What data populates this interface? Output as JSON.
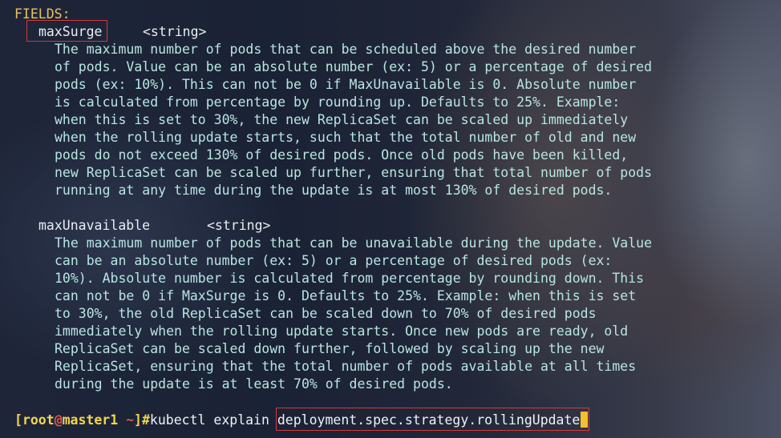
{
  "terminal": {
    "fields_header": "FIELDS:",
    "fields": [
      {
        "name": "maxSurge",
        "type": "<string>",
        "description": [
          "The maximum number of pods that can be scheduled above the desired number",
          "of pods. Value can be an absolute number (ex: 5) or a percentage of desired",
          "pods (ex: 10%). This can not be 0 if MaxUnavailable is 0. Absolute number",
          "is calculated from percentage by rounding up. Defaults to 25%. Example:",
          "when this is set to 30%, the new ReplicaSet can be scaled up immediately",
          "when the rolling update starts, such that the total number of old and new",
          "pods do not exceed 130% of desired pods. Once old pods have been killed,",
          "new ReplicaSet can be scaled up further, ensuring that total number of pods",
          "running at any time during the update is at most 130% of desired pods."
        ]
      },
      {
        "name": "maxUnavailable",
        "type": "<string>",
        "description": [
          "The maximum number of pods that can be unavailable during the update. Value",
          "can be an absolute number (ex: 5) or a percentage of desired pods (ex:",
          "10%). Absolute number is calculated from percentage by rounding down. This",
          "can not be 0 if MaxSurge is 0. Defaults to 25%. Example: when this is set",
          "to 30%, the old ReplicaSet can be scaled down to 70% of desired pods",
          "immediately when the rolling update starts. Once new pods are ready, old",
          "ReplicaSet can be scaled down further, followed by scaling up the new",
          "ReplicaSet, ensuring that the total number of pods available at all times",
          "during the update is at least 70% of desired pods."
        ]
      }
    ],
    "prompt": {
      "open_bracket": "[",
      "user": "root",
      "at": "@",
      "host": "master1",
      "space": " ",
      "cwd": "~",
      "close_bracket": "]",
      "symbol": "#",
      "command": "kubectl explain ",
      "argument": "deployment.spec.strategy.rollingUpdate"
    },
    "colors": {
      "description_text": "#b7e6e2",
      "fields_header": "#e8c35a",
      "prompt_yellow": "#f2d64b",
      "prompt_red": "#e05555",
      "highlight_border": "#d23a3a",
      "cursor": "#f2c12e"
    }
  }
}
